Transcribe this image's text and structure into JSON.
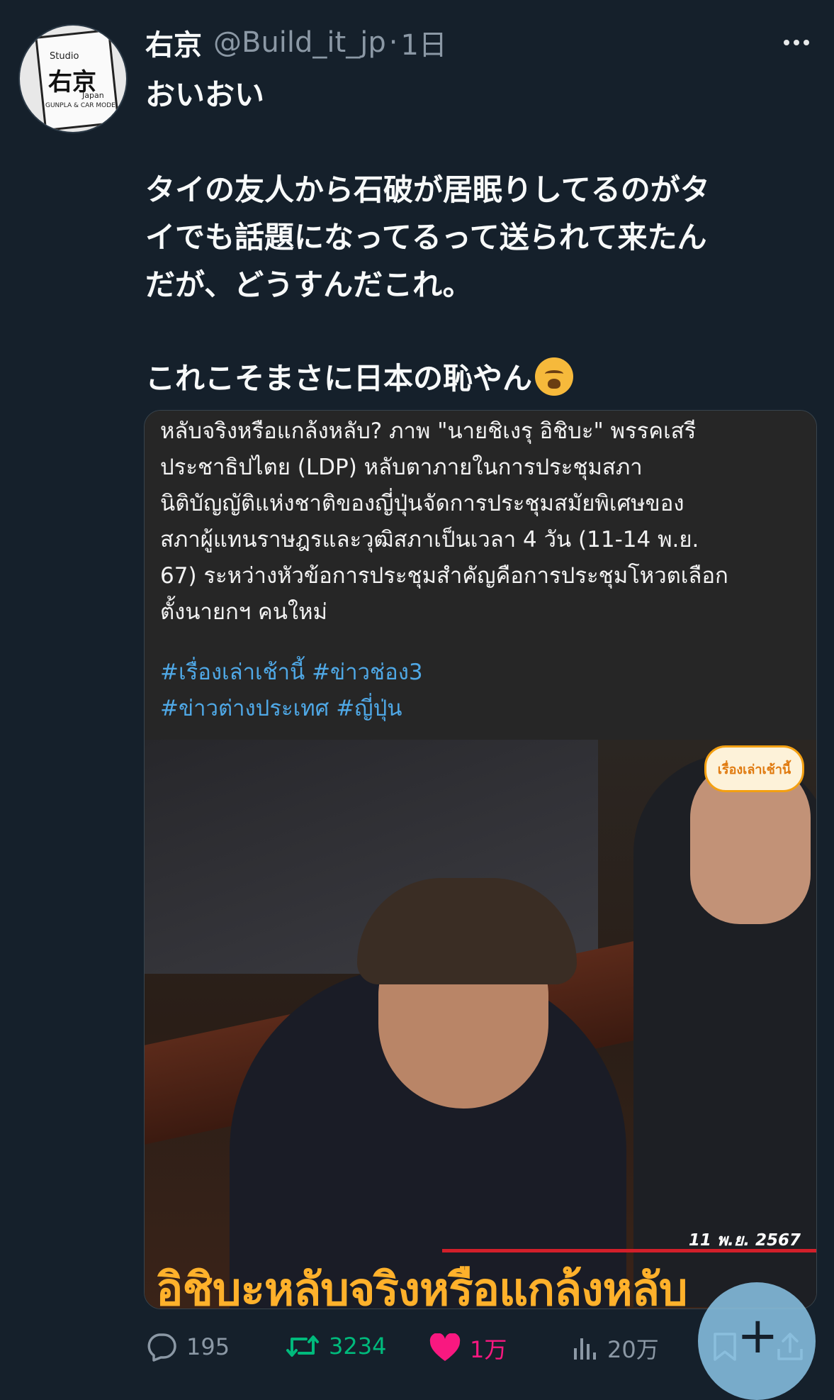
{
  "tweet": {
    "author_name": "右京",
    "handle": "@Build_it_jp",
    "separator": "·",
    "time": "1日",
    "lines": [
      "おいおい",
      "",
      "タイの友人から石破が居眠りしてるのがタ",
      "イでも話題になってるって送られて来たん",
      "だが、どうすんだこれ。",
      "",
      "これこそまさに日本の恥やん"
    ],
    "emoji": "weary-face-emoji"
  },
  "avatar": {
    "studio": "Studio",
    "kanji": "右京",
    "japan": "Japan",
    "tagline": "GUNPLA & CAR MODEL"
  },
  "media": {
    "thai_text": "หลับจริงหรือแกล้งหลับ? ภาพ \"นายชิเงรุ อิชิบะ\" พรรคเสรี\nประชาธิปไตย (LDP)  หลับตาภายในการประชุมสภา\nนิติบัญญัติแห่งชาติของญี่ปุ่นจัดการประชุมสมัยพิเศษของ\nสภาผู้แทนราษฎรและวุฒิสภาเป็นเวลา 4 วัน (11-14 พ.ย.\n67) ระหว่างหัวข้อการประชุมสำคัญคือการประชุมโหวตเลือก\nตั้งนายกฯ คนใหม่",
    "hashtags_line1": "#เรื่องเล่าเช้านี้ #ข่าวช่อง3",
    "hashtags_line2": "#ข่าวต่างประเทศ #ญี่ปุ่น",
    "badge": "เรื่องเล่าเช้านี้",
    "date": "11 พ.ย. 2567",
    "caption": "อิชิบะหลับจริงหรือแกล้งหลับ"
  },
  "actions": {
    "replies": "195",
    "retweets": "3234",
    "likes": "1万",
    "views": "20万"
  },
  "colors": {
    "background": "#15202b",
    "retweet": "#00ba7c",
    "like": "#f91880",
    "hashtag": "#4fa8e6"
  }
}
